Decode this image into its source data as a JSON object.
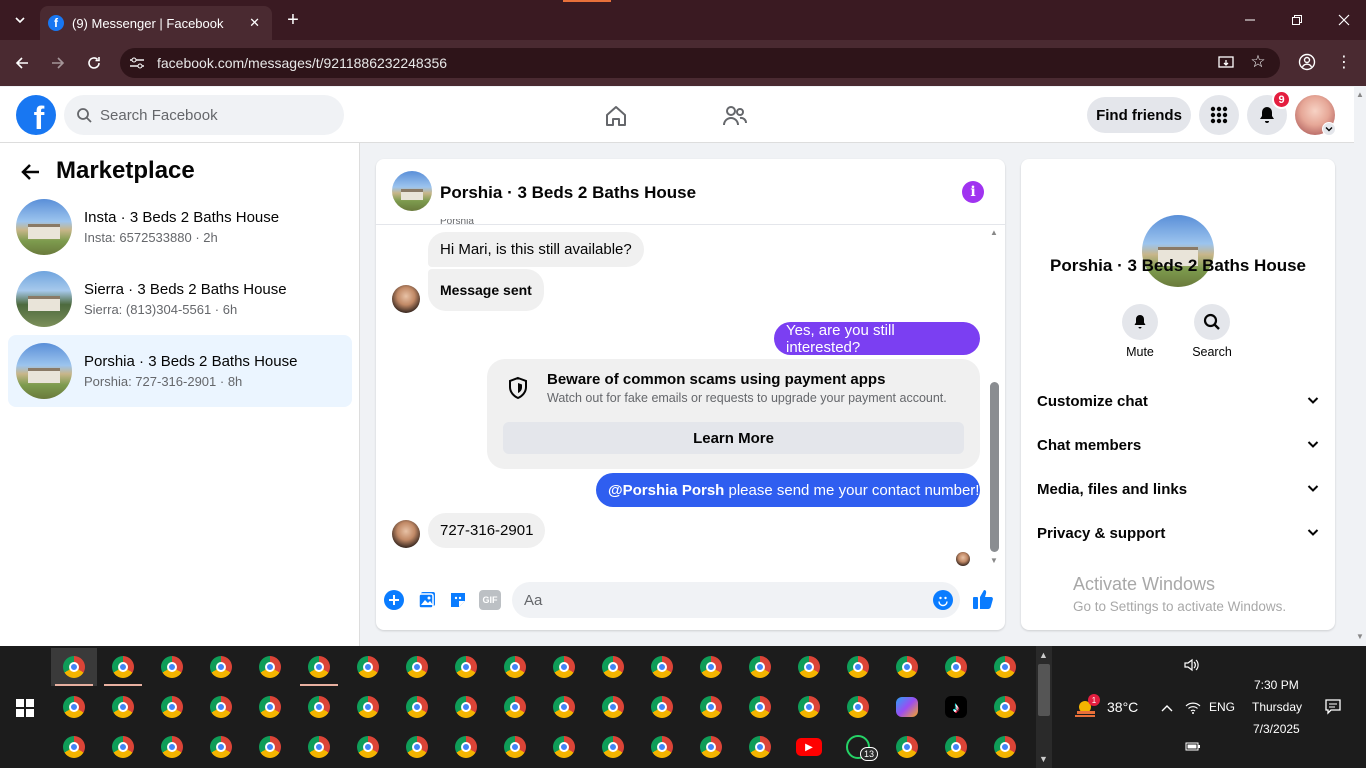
{
  "browser": {
    "tab_title": "(9) Messenger | Facebook",
    "tab_close": "✕",
    "new_tab": "+",
    "url": "facebook.com/messages/t/9211886232248356"
  },
  "header": {
    "search_placeholder": "Search Facebook",
    "find_friends": "Find friends",
    "notification_count": "9"
  },
  "sidebar": {
    "title": "Marketplace",
    "conversations": [
      {
        "name": "Insta · 3 Beds 2 Baths House",
        "sub": "Insta: 6572533880 · 2h"
      },
      {
        "name": "Sierra · 3 Beds 2 Baths House",
        "sub": "Sierra: (813)304-5561 · 6h"
      },
      {
        "name": "Porshia · 3 Beds 2 Baths House",
        "sub": "Porshia: 727-316-2901 · 8h"
      }
    ]
  },
  "chat": {
    "title": "Porshia · 3 Beds 2 Baths House",
    "sender_label": "Porshia",
    "messages": {
      "m1": "Hi Mari, is this still available?",
      "m2": "Message sent",
      "m3": "Yes, are you still interested?",
      "m4_mention": "@Porshia Porsh",
      "m4_text": " please send me your contact number!",
      "m5": "727-316-2901"
    },
    "warning": {
      "title": "Beware of common scams using payment apps",
      "body": "Watch out for fake emails or requests to upgrade your payment account.",
      "button": "Learn More"
    },
    "composer_placeholder": "Aa",
    "gif_label": "GIF"
  },
  "info": {
    "name": "Porshia · 3 Beds 2 Baths House",
    "mute": "Mute",
    "search": "Search",
    "sections": [
      "Customize chat",
      "Chat members",
      "Media, files and links",
      "Privacy & support"
    ],
    "watermark_title": "Activate Windows",
    "watermark_sub": "Go to Settings to activate Windows."
  },
  "taskbar": {
    "temperature": "38°C",
    "weather_badge": "1",
    "language": "ENG",
    "time": "7:30 PM",
    "day": "Thursday",
    "date": "7/3/2025",
    "whatsapp_badge": "13",
    "tiktok_label": "♪",
    "youtube_label": "▶"
  },
  "colors": {
    "facebook_blue": "#1877f2",
    "messenger_purple": "#7b3ff2",
    "outgoing_blue": "#2f5ef0",
    "badge_red": "#e41e3f"
  }
}
